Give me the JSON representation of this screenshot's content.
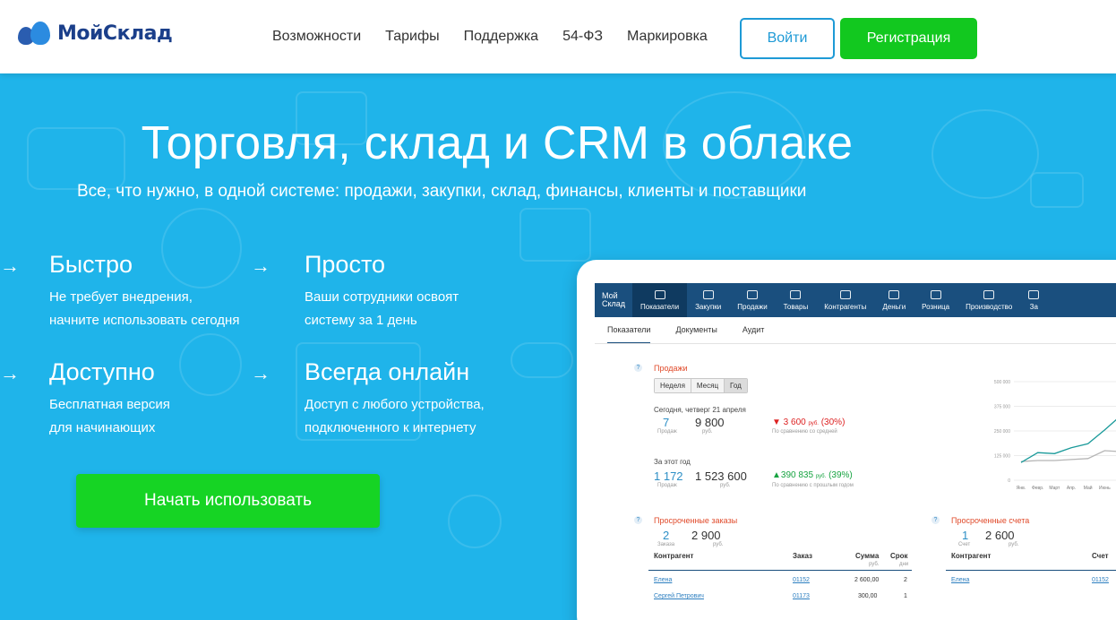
{
  "header": {
    "logo_text": "МойСклад",
    "nav": [
      "Возможности",
      "Тарифы",
      "Поддержка",
      "54-ФЗ",
      "Маркировка"
    ],
    "login": "Войти",
    "register": "Регистрация",
    "colors": {
      "brand_dark": "#1b3f8a",
      "accent": "#1e9ad6",
      "green": "#12c81f"
    }
  },
  "hero": {
    "title": "Торговля, склад и CRM в облаке",
    "subtitle": "Все, что нужно, в одной системе: продажи, закупки, склад, финансы, клиенты и поставщики",
    "features": [
      {
        "arrow": "→",
        "title": "Быстро",
        "desc1": "Не требует внедрения,",
        "desc2": "начните использовать сегодня"
      },
      {
        "arrow": "→",
        "title": "Просто",
        "desc1": "Ваши сотрудники освоят",
        "desc2": "систему за 1 день"
      },
      {
        "arrow": "→",
        "title": "Доступно",
        "desc1": "Бесплатная версия",
        "desc2": "для начинающих"
      },
      {
        "arrow": "→",
        "title": "Всегда онлайн",
        "desc1": "Доступ с любого устройства,",
        "desc2": "подключенного к интернету"
      }
    ],
    "cta": "Начать использовать",
    "bg_color": "#1fb4ea"
  },
  "app": {
    "logo_line1": "Мой",
    "logo_line2": "Склад",
    "nav": [
      "Показатели",
      "Закупки",
      "Продажи",
      "Товары",
      "Контрагенты",
      "Деньги",
      "Розница",
      "Производство",
      "За"
    ],
    "tabs": [
      "Показатели",
      "Документы",
      "Аудит"
    ],
    "sales": {
      "title": "Продажи",
      "periods": [
        "Неделя",
        "Месяц",
        "Год"
      ],
      "today_label": "Сегодня, четверг 21 апреля",
      "today_count": "7",
      "today_count_cap": "Продаж",
      "today_sum": "9 800",
      "today_sum_cap": "руб.",
      "today_delta": "▼ 3 600",
      "today_delta_unit": "руб.",
      "today_delta_pct": "(30%)",
      "today_delta_cap": "По сравнению со средней",
      "year_label": "За этот год",
      "year_count": "1 172",
      "year_count_cap": "Продаж",
      "year_sum": "1 523 600",
      "year_sum_cap": "руб.",
      "year_delta": "▲390 835",
      "year_delta_unit": "руб.",
      "year_delta_pct": "(39%)",
      "year_delta_cap": "По сравнению с прошлым годом"
    },
    "overdue_orders": {
      "title": "Просроченные заказы",
      "count": "2",
      "count_cap": "Заказа",
      "sum": "2 900",
      "sum_cap": "руб.",
      "headers": [
        "Контрагент",
        "Заказ",
        "Сумма",
        "Срок"
      ],
      "sum_sub": "руб.",
      "term_sub": "дни",
      "rows": [
        {
          "party": "Елена",
          "order": "01152",
          "sum": "2 600,00",
          "term": "2"
        },
        {
          "party": "Сергей Петрович",
          "order": "01173",
          "sum": "300,00",
          "term": "1"
        }
      ]
    },
    "overdue_invoices": {
      "title": "Просроченные счета",
      "count": "1",
      "count_cap": "Счет",
      "sum": "2 600",
      "sum_cap": "руб.",
      "headers": [
        "Контрагент",
        "Счет"
      ],
      "rows": [
        {
          "party": "Елена",
          "invoice": "01152"
        }
      ]
    }
  },
  "chart_data": {
    "type": "line",
    "categories": [
      "Янв.",
      "Февр.",
      "Март",
      "Апр.",
      "Май",
      "Июнь",
      "Июль"
    ],
    "ylim": [
      0,
      500000
    ],
    "yticks": [
      "500 000",
      "375 000",
      "250 000",
      "125 000",
      "0"
    ],
    "series": [
      {
        "values": [
          90000,
          140000,
          135000,
          165000,
          185000,
          255000,
          330000
        ],
        "color": "#1a9a9a"
      },
      {
        "values": [
          95000,
          100000,
          100000,
          105000,
          110000,
          150000,
          145000
        ],
        "color": "#b5b5b5"
      }
    ]
  }
}
